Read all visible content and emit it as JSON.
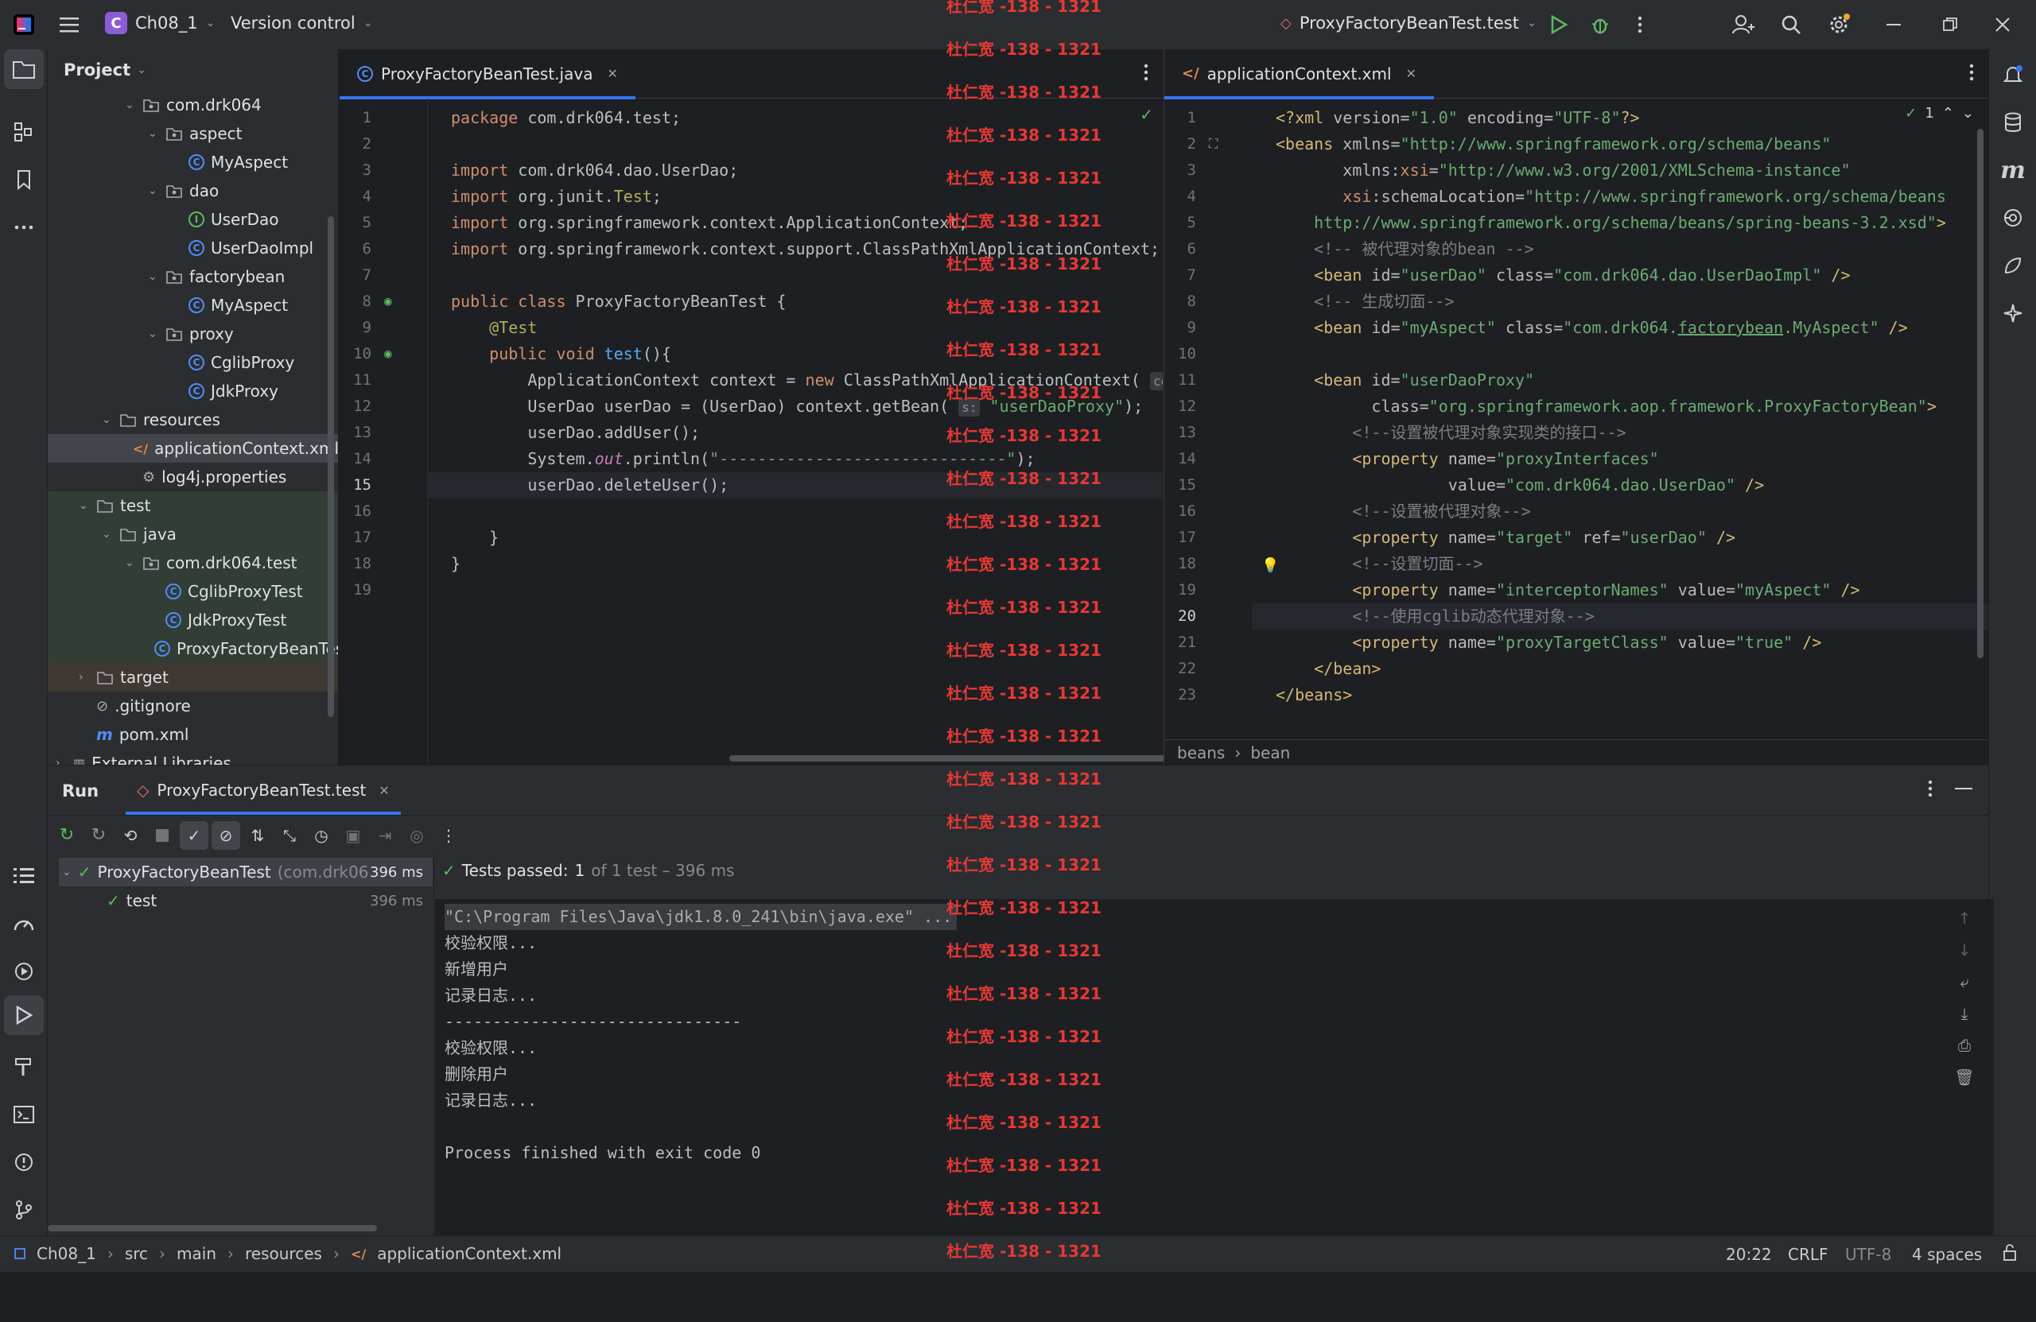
{
  "titlebar": {
    "project_badge": "C",
    "project": "Ch08_1",
    "vcs": "Version control",
    "run_config": "ProxyFactoryBeanTest.test"
  },
  "project_panel": {
    "title": "Project",
    "tree": [
      {
        "label": "com.drk064",
        "icon": "package-icon",
        "depth": 3,
        "open": true
      },
      {
        "label": "aspect",
        "icon": "package-icon",
        "depth": 4,
        "open": true
      },
      {
        "label": "MyAspect",
        "icon": "class-icon",
        "depth": 5
      },
      {
        "label": "dao",
        "icon": "package-icon",
        "depth": 4,
        "open": true
      },
      {
        "label": "UserDao",
        "icon": "interface-icon",
        "depth": 5
      },
      {
        "label": "UserDaoImpl",
        "icon": "class-icon",
        "depth": 5
      },
      {
        "label": "factorybean",
        "icon": "package-icon",
        "depth": 4,
        "open": true
      },
      {
        "label": "MyAspect",
        "icon": "class-icon",
        "depth": 5
      },
      {
        "label": "proxy",
        "icon": "package-icon",
        "depth": 4,
        "open": true
      },
      {
        "label": "CglibProxy",
        "icon": "class-icon",
        "depth": 5
      },
      {
        "label": "JdkProxy",
        "icon": "class-icon",
        "depth": 5
      },
      {
        "label": "resources",
        "icon": "folder-icon",
        "depth": 2,
        "open": true
      },
      {
        "label": "applicationContext.xml",
        "icon": "xml-icon",
        "depth": 3,
        "selected": true
      },
      {
        "label": "log4j.properties",
        "icon": "gear-icon",
        "depth": 3
      },
      {
        "label": "test",
        "icon": "folder-icon",
        "depth": 1,
        "open": true
      },
      {
        "label": "java",
        "icon": "folder-icon",
        "depth": 2,
        "open": true
      },
      {
        "label": "com.drk064.test",
        "icon": "package-icon",
        "depth": 3,
        "open": true
      },
      {
        "label": "CglibProxyTest",
        "icon": "class-icon",
        "depth": 4
      },
      {
        "label": "JdkProxyTest",
        "icon": "class-icon",
        "depth": 4
      },
      {
        "label": "ProxyFactoryBeanTest",
        "icon": "class-icon",
        "depth": 4
      },
      {
        "label": "target",
        "icon": "folder-icon",
        "depth": 1,
        "closed": true
      },
      {
        "label": ".gitignore",
        "icon": "ignore-icon",
        "depth": 1
      },
      {
        "label": "pom.xml",
        "icon": "maven-icon",
        "depth": 1
      },
      {
        "label": "External Libraries",
        "icon": "library-icon",
        "depth": 0,
        "closed": true
      }
    ]
  },
  "editor_left": {
    "tab": "ProxyFactoryBeanTest.java",
    "lines": [
      [
        [
          "kw",
          "package "
        ],
        [
          "t",
          "com.drk064.test;"
        ]
      ],
      [],
      [
        [
          "kw",
          "import "
        ],
        [
          "t",
          "com.drk064.dao.UserDao;"
        ]
      ],
      [
        [
          "kw",
          "import "
        ],
        [
          "t",
          "org.junit."
        ],
        [
          "ann",
          "Test"
        ],
        [
          "t",
          ";"
        ]
      ],
      [
        [
          "kw",
          "import "
        ],
        [
          "t",
          "org.springframework.context.ApplicationContext;"
        ]
      ],
      [
        [
          "kw",
          "import "
        ],
        [
          "t",
          "org.springframework.context.support.ClassPathXmlApplicationContext;"
        ]
      ],
      [],
      [
        [
          "kw",
          "public class "
        ],
        [
          "t",
          "ProxyFactoryBeanTest {"
        ]
      ],
      [
        [
          "t",
          "    "
        ],
        [
          "ann",
          "@Test"
        ]
      ],
      [
        [
          "t",
          "    "
        ],
        [
          "kw",
          "public void "
        ],
        [
          "fn",
          "test"
        ],
        [
          "t",
          "(){"
        ]
      ],
      [
        [
          "t",
          "        ApplicationContext context = "
        ],
        [
          "kw",
          "new "
        ],
        [
          "t",
          "ClassPathXmlApplicationContext( "
        ],
        [
          "hint",
          "config"
        ]
      ],
      [
        [
          "t",
          "        UserDao userDao = (UserDao) context.getBean( "
        ],
        [
          "hint",
          "s:"
        ],
        [
          "str",
          " \"userDaoProxy\""
        ],
        [
          "t",
          ");"
        ]
      ],
      [
        [
          "t",
          "        userDao.addUser();"
        ]
      ],
      [
        [
          "t",
          "        System."
        ],
        [
          "it",
          "out"
        ],
        [
          "t",
          ".println("
        ],
        [
          "str",
          "\"------------------------------\""
        ],
        [
          "t",
          ");"
        ]
      ],
      [
        [
          "t",
          "        userDao.deleteUser();"
        ]
      ],
      [],
      [
        [
          "t",
          "    }"
        ]
      ],
      [
        [
          "t",
          "}"
        ]
      ],
      []
    ]
  },
  "editor_right": {
    "tab": "applicationContext.xml",
    "inspection": "1",
    "breadcrumb": [
      "beans",
      "bean"
    ],
    "lines": [
      [
        [
          "tag",
          "<?xml "
        ],
        [
          "attr",
          "version="
        ],
        [
          "str",
          "\"1.0\" "
        ],
        [
          "attr",
          "encoding="
        ],
        [
          "str",
          "\"UTF-8\""
        ],
        [
          "tag",
          "?>"
        ]
      ],
      [
        [
          "tag",
          "<beans "
        ],
        [
          "attr",
          "xmlns="
        ],
        [
          "str",
          "\"http://www.springframework.org/schema/beans\""
        ]
      ],
      [
        [
          "t",
          "       "
        ],
        [
          "attr",
          "xmlns:"
        ],
        [
          "kw",
          "xsi"
        ],
        [
          "attr",
          "="
        ],
        [
          "str",
          "\"http://www.w3.org/2001/XMLSchema-instance\""
        ]
      ],
      [
        [
          "t",
          "       "
        ],
        [
          "kw",
          "xsi"
        ],
        [
          "attr",
          ":schemaLocation="
        ],
        [
          "str",
          "\"http://www.springframework.org/schema/beans"
        ]
      ],
      [
        [
          "str",
          "    http://www.springframework.org/schema/beans/spring-beans-3.2.xsd\""
        ],
        [
          "tag",
          ">"
        ]
      ],
      [
        [
          "c",
          "    <!-- 被代理对象的bean -->"
        ]
      ],
      [
        [
          "tag",
          "    <bean "
        ],
        [
          "attr",
          "id="
        ],
        [
          "str",
          "\"userDao\" "
        ],
        [
          "attr",
          "class="
        ],
        [
          "str",
          "\"com.drk064.dao.UserDaoImpl\" "
        ],
        [
          "tag",
          "/>"
        ]
      ],
      [
        [
          "c",
          "    <!-- 生成切面-->"
        ]
      ],
      [
        [
          "tag",
          "    <bean "
        ],
        [
          "attr",
          "id="
        ],
        [
          "str",
          "\"myAspect\" "
        ],
        [
          "attr",
          "class="
        ],
        [
          "str",
          "\"com.drk064."
        ],
        [
          "ul",
          "factorybean"
        ],
        [
          "str",
          ".MyAspect\" "
        ],
        [
          "tag",
          "/>"
        ]
      ],
      [],
      [
        [
          "tag",
          "    <bean "
        ],
        [
          "attr",
          "id="
        ],
        [
          "str",
          "\"userDaoProxy\""
        ]
      ],
      [
        [
          "t",
          "          "
        ],
        [
          "attr",
          "class="
        ],
        [
          "str",
          "\"org.springframework.aop.framework.ProxyFactoryBean\""
        ],
        [
          "tag",
          ">"
        ]
      ],
      [
        [
          "c",
          "        <!--设置被代理对象实现类的接口-->"
        ]
      ],
      [
        [
          "tag",
          "        <property "
        ],
        [
          "attr",
          "name="
        ],
        [
          "str",
          "\"proxyInterfaces\""
        ]
      ],
      [
        [
          "t",
          "                  "
        ],
        [
          "attr",
          "value="
        ],
        [
          "str",
          "\"com.drk064.dao.UserDao\" "
        ],
        [
          "tag",
          "/>"
        ]
      ],
      [
        [
          "c",
          "        <!--设置被代理对象-->"
        ]
      ],
      [
        [
          "tag",
          "        <property "
        ],
        [
          "attr",
          "name="
        ],
        [
          "str",
          "\"target\" "
        ],
        [
          "attr",
          "ref="
        ],
        [
          "str",
          "\"userDao\" "
        ],
        [
          "tag",
          "/>"
        ]
      ],
      [
        [
          "c",
          "        <!--设置切面-->"
        ]
      ],
      [
        [
          "tag",
          "        <property "
        ],
        [
          "attr",
          "name="
        ],
        [
          "str",
          "\"interceptorNames\" "
        ],
        [
          "attr",
          "value="
        ],
        [
          "str",
          "\"myAspect\" "
        ],
        [
          "tag",
          "/>"
        ]
      ],
      [
        [
          "c",
          "        <!--使用cglib动态代理对象-->"
        ]
      ],
      [
        [
          "tag",
          "        <property "
        ],
        [
          "attr",
          "name="
        ],
        [
          "str",
          "\"proxyTargetClass\" "
        ],
        [
          "attr",
          "value="
        ],
        [
          "str",
          "\"true\" "
        ],
        [
          "tag",
          "/>"
        ]
      ],
      [
        [
          "tag",
          "    </bean>"
        ]
      ],
      [
        [
          "tag",
          "</beans>"
        ]
      ]
    ]
  },
  "run": {
    "title": "Run",
    "tab": "ProxyFactoryBeanTest.test",
    "summary_prefix": "Tests passed:",
    "summary_count": "1",
    "summary_rest": "of 1 test – 396 ms",
    "tree": [
      {
        "label": "ProxyFactoryBeanTest",
        "sub": "(com.drk06",
        "time": "396 ms"
      },
      {
        "label": "test",
        "time": "396 ms"
      }
    ],
    "console": [
      "\"C:\\Program Files\\Java\\jdk1.8.0_241\\bin\\java.exe\" ...",
      "校验权限...",
      "新增用户",
      "记录日志...",
      "-------------------------------",
      "校验权限...",
      "删除用户",
      "记录日志...",
      "",
      "Process finished with exit code 0"
    ]
  },
  "status": {
    "crumbs": [
      "Ch08_1",
      "src",
      "main",
      "resources",
      "applicationContext.xml"
    ],
    "position": "20:22",
    "line_sep": "CRLF",
    "encoding": "UTF-8",
    "indent": "4 spaces"
  },
  "watermark": "杜仁宽 -138 - 1321",
  "colors": {
    "accent": "#3574f0",
    "pass": "#5fb865",
    "warn": "#f2c55c"
  }
}
